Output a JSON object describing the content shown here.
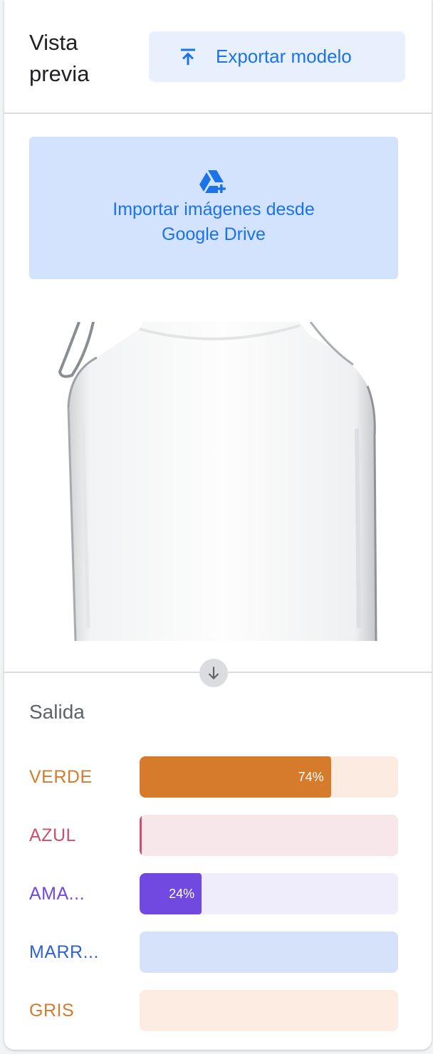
{
  "header": {
    "title": "Vista previa",
    "export_label": "Exportar modelo"
  },
  "import": {
    "label_line1": "Importar imágenes desde",
    "label_line2": "Google Drive"
  },
  "output": {
    "label": "Salida",
    "classes": [
      {
        "label": "VERDE",
        "percent": 74,
        "percent_text": "74%",
        "text_color": "#d67a2c",
        "fill_color": "#d67a2c",
        "track_color": "#fbebe1"
      },
      {
        "label": "AZUL",
        "percent": 0.5,
        "percent_text": "",
        "text_color": "#c9506f",
        "fill_color": "#c9506f",
        "track_color": "#f8e7ea"
      },
      {
        "label": "AMA...",
        "percent": 24,
        "percent_text": "24%",
        "text_color": "#7249e0",
        "fill_color": "#7249e0",
        "track_color": "#efedfc"
      },
      {
        "label": "MARR...",
        "percent": 0,
        "percent_text": "",
        "text_color": "#2f63d0",
        "fill_color": "#2f63d0",
        "track_color": "#d5e2fa"
      },
      {
        "label": "GRIS",
        "percent": 0,
        "percent_text": "",
        "text_color": "#d67a2c",
        "fill_color": "#d67a2c",
        "track_color": "#fcece1"
      }
    ]
  },
  "icons": {
    "export": "upload-arrow-icon",
    "import": "google-drive-add-icon",
    "scroll": "arrow-down-icon"
  }
}
